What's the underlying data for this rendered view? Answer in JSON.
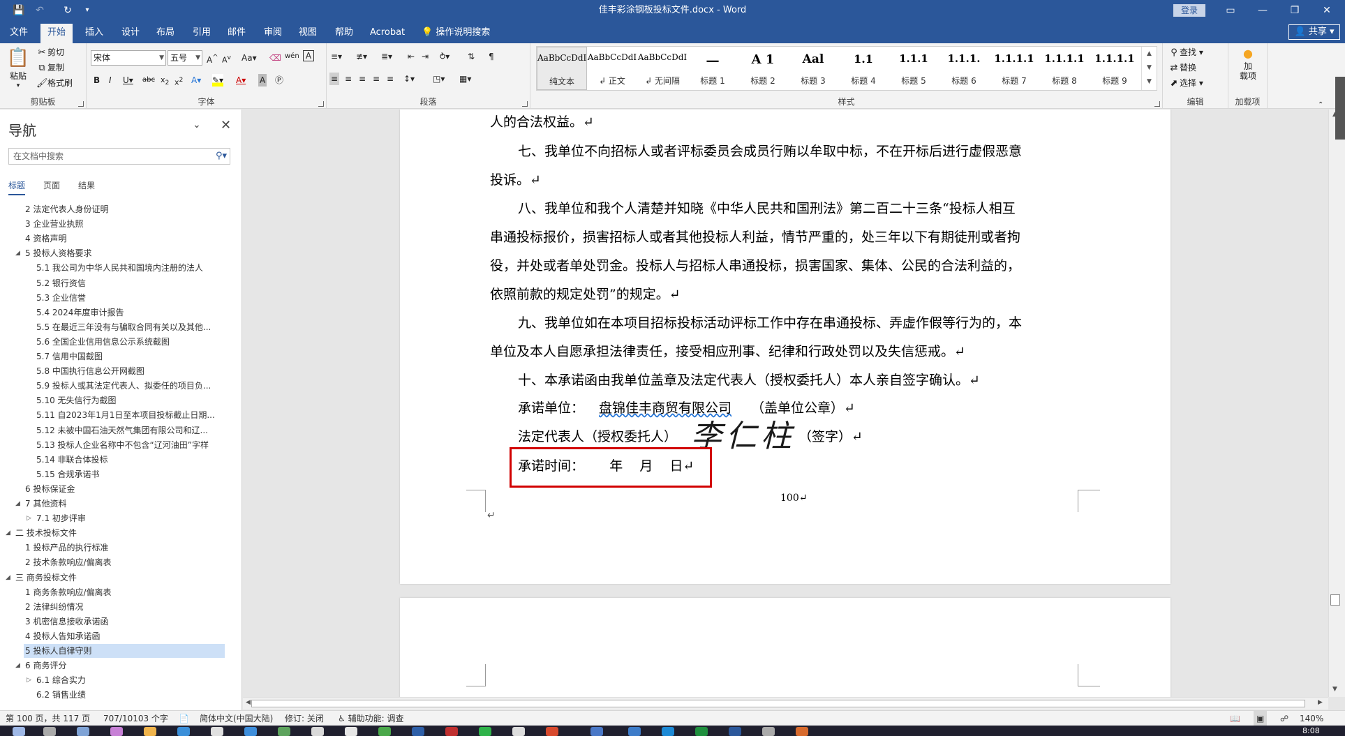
{
  "titlebar": {
    "title": "佳丰彩涂钢板投标文件.docx  -  Word",
    "signin": "登录",
    "qa_save_icon": "save-icon",
    "qa_undo_icon": "undo-icon",
    "qa_redo_icon": "redo-icon"
  },
  "tabs": [
    "文件",
    "开始",
    "插入",
    "设计",
    "布局",
    "引用",
    "邮件",
    "审阅",
    "视图",
    "帮助",
    "Acrobat"
  ],
  "tellme": "操作说明搜索",
  "share": "共享",
  "ribbon": {
    "clipboard": {
      "paste": "粘贴",
      "cut": "剪切",
      "copy": "复制",
      "format_painter": "格式刷",
      "label": "剪贴板"
    },
    "font": {
      "name": "宋体",
      "size": "五号",
      "label": "字体"
    },
    "paragraph": {
      "label": "段落"
    },
    "styles": {
      "label": "样式",
      "items": [
        {
          "preview": "AaBbCcDdI",
          "name": "纯文本"
        },
        {
          "preview": "AaBbCcDdI",
          "name": "↲ 正文"
        },
        {
          "preview": "AaBbCcDdI",
          "name": "↲ 无间隔"
        },
        {
          "preview": "一",
          "name": "标题 1"
        },
        {
          "preview": "A 1",
          "name": "标题 2"
        },
        {
          "preview": "Aal",
          "name": "标题 3"
        },
        {
          "preview": "1.1",
          "name": "标题 4"
        },
        {
          "preview": "1.1.1",
          "name": "标题 5"
        },
        {
          "preview": "1.1.1.",
          "name": "标题 6"
        },
        {
          "preview": "1.1.1.1",
          "name": "标题 7"
        },
        {
          "preview": "1.1.1.1",
          "name": "标题 8"
        },
        {
          "preview": "1.1.1.1",
          "name": "标题 9"
        }
      ]
    },
    "editing": {
      "find": "查找",
      "replace": "替换",
      "select": "选择",
      "label": "编辑"
    },
    "addins": {
      "button": "加\n载项",
      "label": "加载项"
    }
  },
  "nav": {
    "title": "导航",
    "search_placeholder": "在文档中搜索",
    "tabs": [
      "标题",
      "页面",
      "结果"
    ],
    "items": [
      {
        "text": "2 法定代表人身份证明",
        "level": 2
      },
      {
        "text": "3 企业营业执照",
        "level": 2
      },
      {
        "text": "4 资格声明",
        "level": 2
      },
      {
        "text": "5 投标人资格要求",
        "level": 2,
        "expanded": true
      },
      {
        "text": "5.1 我公司为中华人民共和国境内注册的法人",
        "level": 3
      },
      {
        "text": "5.2 银行资信",
        "level": 3
      },
      {
        "text": "5.3 企业信誉",
        "level": 3
      },
      {
        "text": "5.4 2024年度审计报告",
        "level": 3
      },
      {
        "text": "5.5 在最近三年没有与骗取合同有关以及其他...",
        "level": 3
      },
      {
        "text": "5.6 全国企业信用信息公示系统截图",
        "level": 3
      },
      {
        "text": "5.7 信用中国截图",
        "level": 3
      },
      {
        "text": "5.8 中国执行信息公开网截图",
        "level": 3
      },
      {
        "text": "5.9 投标人或其法定代表人、拟委任的项目负...",
        "level": 3
      },
      {
        "text": "5.10 无失信行为截图",
        "level": 3
      },
      {
        "text": "5.11 自2023年1月1日至本项目投标截止日期...",
        "level": 3
      },
      {
        "text": "5.12 未被中国石油天然气集团有限公司和辽...",
        "level": 3
      },
      {
        "text": "5.13 投标人企业名称中不包含“辽河油田”字样",
        "level": 3
      },
      {
        "text": "5.14 非联合体投标",
        "level": 3
      },
      {
        "text": "5.15 合规承诺书",
        "level": 3
      },
      {
        "text": "6 投标保证金",
        "level": 2
      },
      {
        "text": "7 其他资料",
        "level": 2,
        "expanded": true
      },
      {
        "text": "7.1 初步评审",
        "level": 3,
        "collapsed": true
      },
      {
        "text": "二 技术投标文件",
        "level": 1,
        "expanded": true
      },
      {
        "text": "1 投标产品的执行标准",
        "level": 2
      },
      {
        "text": "2 技术条款响应/偏离表",
        "level": 2
      },
      {
        "text": "三 商务投标文件",
        "level": 1,
        "expanded": true
      },
      {
        "text": "1 商务条款响应/偏离表",
        "level": 2
      },
      {
        "text": "2 法律纠纷情况",
        "level": 2
      },
      {
        "text": "3 机密信息接收承诺函",
        "level": 2
      },
      {
        "text": "4 投标人告知承诺函",
        "level": 2
      },
      {
        "text": "5 投标人自律守则",
        "level": 2,
        "selected": true
      },
      {
        "text": "6 商务评分",
        "level": 2,
        "expanded": true
      },
      {
        "text": "6.1 综合实力",
        "level": 3,
        "collapsed": true
      },
      {
        "text": "6.2 销售业绩",
        "level": 3
      }
    ]
  },
  "document": {
    "lines": [
      "人的合法权益。↵",
      "七、我单位不向招标人或者评标委员会成员行贿以牟取中标，不在开标后进行虚假恶意",
      "投诉。↵",
      "八、我单位和我个人清楚并知晓《中华人民共和国刑法》第二百二十三条“投标人相互",
      "串通投标报价，损害招标人或者其他投标人利益，情节严重的，处三年以下有期徒刑或者拘",
      "役，并处或者单处罚金。投标人与招标人串通投标，损害国家、集体、公民的合法利益的，",
      "依照前款的规定处罚”的规定。↵",
      "九、我单位如在本项目招标投标活动评标工作中存在串通投标、弄虚作假等行为的，本",
      "单位及本人自愿承担法律责任，接受相应刑事、纪律和行政处罚以及失信惩戒。↵",
      "十、本承诺函由我单位盖章及法定代表人（授权委托人）本人亲自签字确认。↵"
    ],
    "promise_unit_label": "承诺单位：",
    "promise_unit_value": "盘锦佳丰商贸有限公司",
    "promise_unit_suffix": "（盖单位公章）↵",
    "legal_rep_label": "法定代表人（授权委托人）",
    "legal_rep_suffix": "（签字）↵",
    "signature": "李仁柱",
    "date_line": "承诺时间：      年    月    日↵",
    "page_number": "100↵",
    "para_mark": "↵"
  },
  "status": {
    "page": "第 100 页，共 117 页",
    "words": "707/10103 个字",
    "language": "简体中文(中国大陆)",
    "revisions": "修订: 关闭",
    "accessibility": "辅助功能: 调查",
    "zoom": "140%"
  },
  "taskbar": {
    "clock": "8:08"
  }
}
